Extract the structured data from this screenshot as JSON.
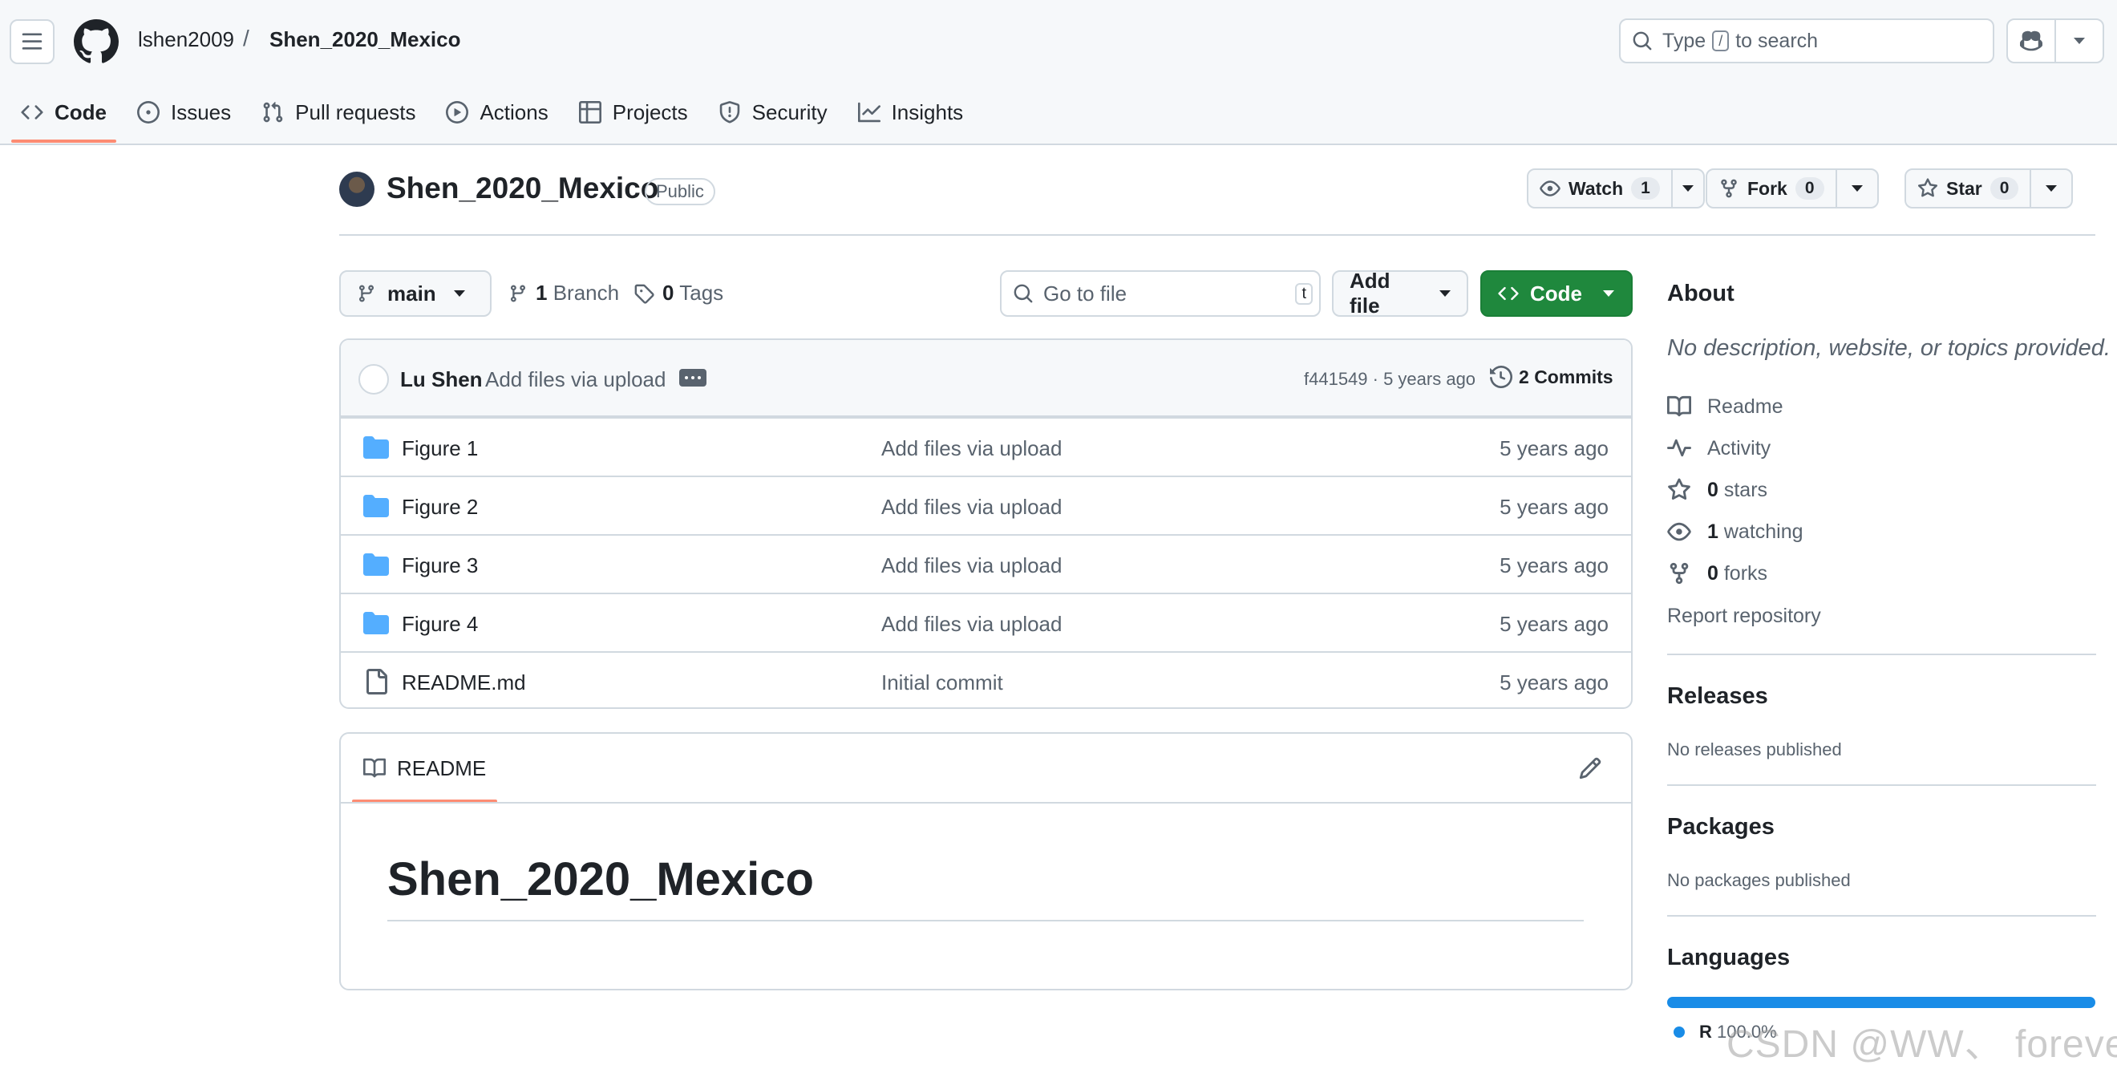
{
  "header": {
    "owner": "lshen2009",
    "separator": "/",
    "repo": "Shen_2020_Mexico",
    "search": {
      "prefix": "Type",
      "key": "/",
      "suffix": "to search"
    }
  },
  "nav": {
    "tabs": [
      {
        "label": "Code",
        "icon": "code-icon",
        "active": true
      },
      {
        "label": "Issues",
        "icon": "issue-icon"
      },
      {
        "label": "Pull requests",
        "icon": "pull-request-icon"
      },
      {
        "label": "Actions",
        "icon": "play-icon"
      },
      {
        "label": "Projects",
        "icon": "table-icon"
      },
      {
        "label": "Security",
        "icon": "shield-icon"
      },
      {
        "label": "Insights",
        "icon": "graph-icon"
      }
    ]
  },
  "repo": {
    "title": "Shen_2020_Mexico",
    "visibility": "Public",
    "watch": {
      "label": "Watch",
      "count": "1"
    },
    "fork": {
      "label": "Fork",
      "count": "0"
    },
    "star": {
      "label": "Star",
      "count": "0"
    }
  },
  "toolbar": {
    "branch": "main",
    "branches_count": "1",
    "branches_label": "Branch",
    "tags_count": "0",
    "tags_label": "Tags",
    "goto_placeholder": "Go to file",
    "goto_key": "t",
    "add_file": "Add file",
    "code": "Code"
  },
  "commit": {
    "author": "Lu Shen",
    "message": "Add files via upload",
    "hash_time": "f441549 · 5 years ago",
    "commits_count": "2",
    "commits_label": "Commits"
  },
  "files": [
    {
      "name": "Figure 1",
      "type": "folder",
      "message": "Add files via upload",
      "time": "5 years ago"
    },
    {
      "name": "Figure 2",
      "type": "folder",
      "message": "Add files via upload",
      "time": "5 years ago"
    },
    {
      "name": "Figure 3",
      "type": "folder",
      "message": "Add files via upload",
      "time": "5 years ago"
    },
    {
      "name": "Figure 4",
      "type": "folder",
      "message": "Add files via upload",
      "time": "5 years ago"
    },
    {
      "name": "README.md",
      "type": "file",
      "message": "Initial commit",
      "time": "5 years ago"
    }
  ],
  "readme": {
    "tab": "README",
    "heading": "Shen_2020_Mexico"
  },
  "sidebar": {
    "about_title": "About",
    "about_desc": "No description, website, or topics provided.",
    "items": [
      {
        "icon": "book-icon",
        "value": "",
        "label": "Readme"
      },
      {
        "icon": "pulse-icon",
        "value": "",
        "label": "Activity"
      },
      {
        "icon": "star-icon",
        "value": "0",
        "label": "stars"
      },
      {
        "icon": "eye-icon",
        "value": "1",
        "label": "watching"
      },
      {
        "icon": "fork-icon",
        "value": "0",
        "label": "forks"
      }
    ],
    "report": "Report repository",
    "releases_title": "Releases",
    "releases_note": "No releases published",
    "packages_title": "Packages",
    "packages_note": "No packages published",
    "languages_title": "Languages",
    "language": {
      "name": "R",
      "percent": "100.0%",
      "color": "#198ce7"
    }
  },
  "watermark": "CSDN @WW、 forever",
  "colors": {
    "accent_tab": "#fd8c73",
    "code_button": "#1f883d",
    "folder": "#54aeff"
  }
}
